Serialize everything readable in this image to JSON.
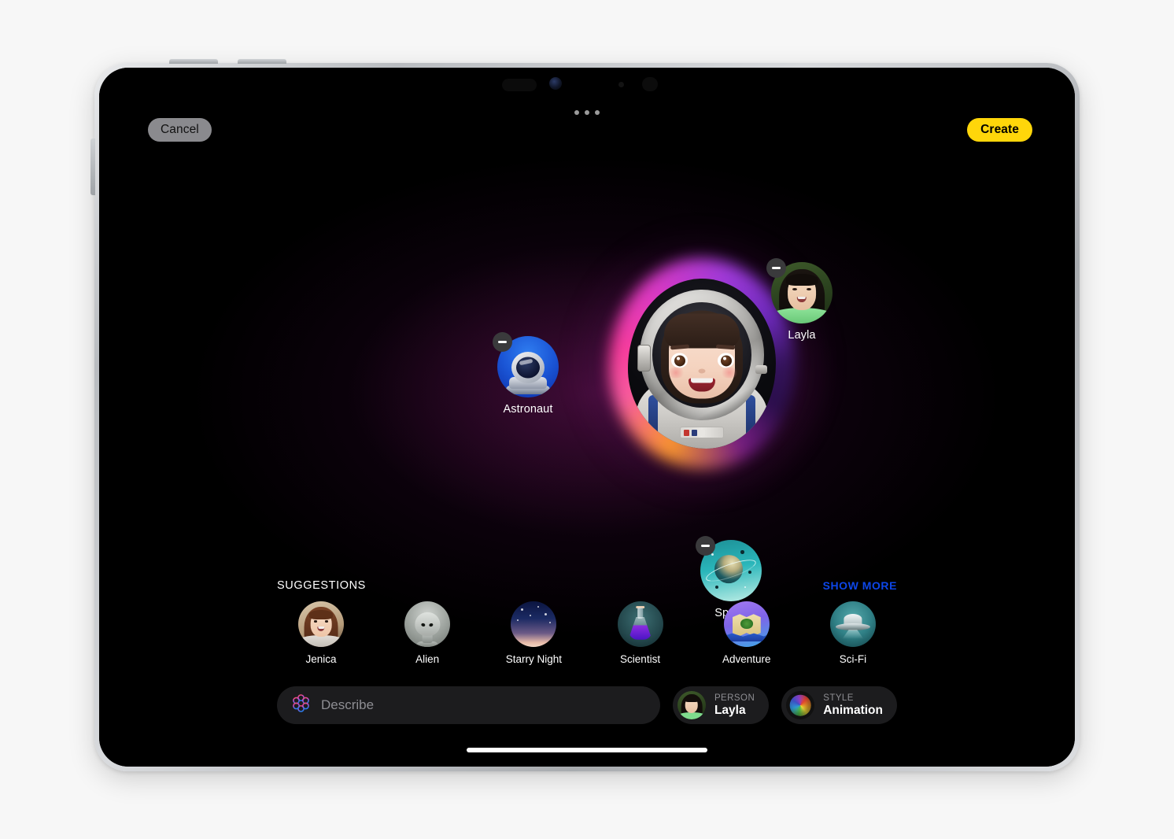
{
  "top_bar": {
    "cancel_label": "Cancel",
    "create_label": "Create",
    "create_color": "#FFD60A",
    "cancel_bg": "#8A8A8E"
  },
  "canvas": {
    "result": {
      "name": "genmoji-result",
      "description": "Astronaut genmoji of Layla in animation style"
    },
    "chips": [
      {
        "label": "Astronaut",
        "icon": "astronaut-helmet-icon",
        "remove_label": "Remove Astronaut"
      },
      {
        "label": "Layla",
        "icon": "person-photo-layla",
        "remove_label": "Remove Layla"
      },
      {
        "label": "Space",
        "icon": "planet-space-icon",
        "remove_label": "Remove Space"
      }
    ]
  },
  "suggestions": {
    "title": "SUGGESTIONS",
    "show_more_label": "SHOW MORE",
    "show_more_color": "#0D46E8",
    "items": [
      {
        "label": "Jenica",
        "icon": "person-photo-jenica"
      },
      {
        "label": "Alien",
        "icon": "alien-head-icon"
      },
      {
        "label": "Starry Night",
        "icon": "starry-night-icon"
      },
      {
        "label": "Scientist",
        "icon": "flask-icon"
      },
      {
        "label": "Adventure",
        "icon": "map-icon"
      },
      {
        "label": "Sci-Fi",
        "icon": "ufo-icon"
      }
    ]
  },
  "bottom_bar": {
    "describe_placeholder": "Describe",
    "describe_value": "",
    "apple_intelligence_icon": "apple-intelligence-icon",
    "person_pill": {
      "kicker": "PERSON",
      "value": "Layla",
      "icon": "person-photo-layla"
    },
    "style_pill": {
      "kicker": "STYLE",
      "value": "Animation",
      "icon": "style-sphere-icon"
    }
  }
}
